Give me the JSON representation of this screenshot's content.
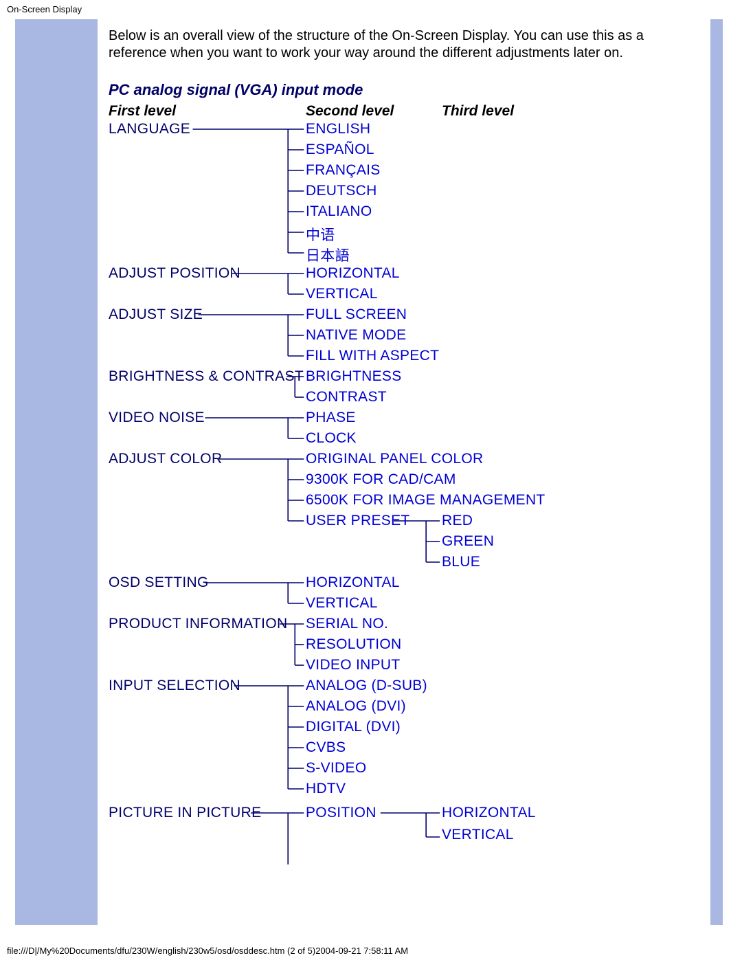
{
  "header": {
    "title": "On-Screen Display"
  },
  "intro": "Below is an overall view of the structure of the On-Screen Display. You can use this as a reference when you want to work your way around the different adjustments later on.",
  "mode_title": "PC analog signal (VGA) input mode",
  "columns": {
    "first": "First level",
    "second": "Second level",
    "third": "Third level"
  },
  "tree": {
    "language": {
      "label": "LANGUAGE",
      "items": [
        "ENGLISH",
        "ESPAÑOL",
        "FRANÇAIS",
        "DEUTSCH",
        "ITALIANO",
        "中语",
        "日本語"
      ]
    },
    "adjpos": {
      "label": "ADJUST POSITION",
      "items": [
        "HORIZONTAL",
        "VERTICAL"
      ]
    },
    "adjsize": {
      "label": "ADJUST SIZE",
      "items": [
        "FULL SCREEN",
        "NATIVE MODE",
        "FILL WITH ASPECT"
      ]
    },
    "bright": {
      "label": "BRIGHTNESS & CONTRAST",
      "items": [
        "BRIGHTNESS",
        "CONTRAST"
      ]
    },
    "noise": {
      "label": "VIDEO NOISE",
      "items": [
        "PHASE",
        "CLOCK"
      ]
    },
    "color": {
      "label": "ADJUST COLOR",
      "items": [
        "ORIGINAL PANEL COLOR",
        "9300K FOR CAD/CAM",
        "6500K FOR IMAGE MANAGEMENT",
        "USER PRESET"
      ],
      "user_preset_items": [
        "RED",
        "GREEN",
        "BLUE"
      ]
    },
    "osd": {
      "label": "OSD SETTING",
      "items": [
        "HORIZONTAL",
        "VERTICAL"
      ]
    },
    "prodinfo": {
      "label": "PRODUCT INFORMATION",
      "items": [
        "SERIAL NO.",
        "RESOLUTION",
        "VIDEO INPUT"
      ]
    },
    "inputsel": {
      "label": "INPUT SELECTION",
      "items": [
        "ANALOG (D-SUB)",
        "ANALOG (DVI)",
        "DIGITAL (DVI)",
        "CVBS",
        "S-VIDEO",
        "HDTV"
      ]
    },
    "pip": {
      "label": "PICTURE IN PICTURE",
      "items": [
        "POSITION"
      ],
      "position_items": [
        "HORIZONTAL",
        "VERTICAL"
      ]
    }
  },
  "footer": "file:///D|/My%20Documents/dfu/230W/english/230w5/osd/osddesc.htm (2 of 5)2004-09-21 7:58:11 AM"
}
